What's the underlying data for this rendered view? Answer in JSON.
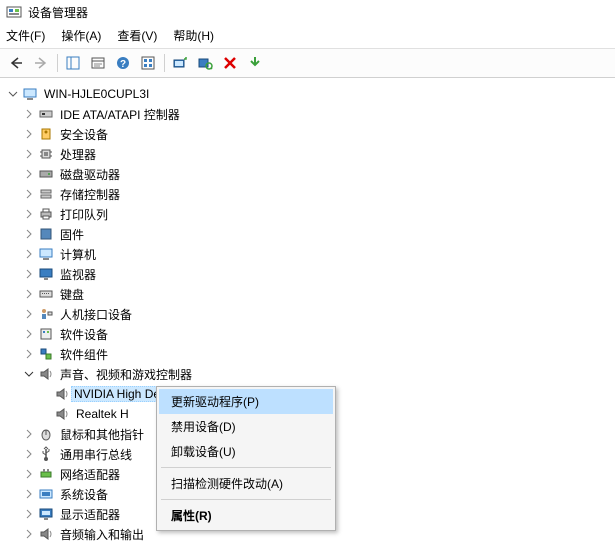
{
  "title": "设备管理器",
  "menus": {
    "file": "文件(F)",
    "action": "操作(A)",
    "view": "查看(V)",
    "help": "帮助(H)"
  },
  "tree": {
    "root": "WIN-HJLE0CUPL3I",
    "items": {
      "ide": "IDE ATA/ATAPI 控制器",
      "security": "安全设备",
      "cpu": "处理器",
      "disk": "磁盘驱动器",
      "storage": "存储控制器",
      "printq": "打印队列",
      "firmware": "固件",
      "computer": "计算机",
      "monitor": "监视器",
      "keyboard": "键盘",
      "hid": "人机接口设备",
      "software_devices": "软件设备",
      "software_components": "软件组件",
      "sound": "声音、视频和游戏控制器",
      "sound_children": {
        "nvidia": "NVIDIA High Definition Audio",
        "realtek": "Realtek H"
      },
      "mouse": "鼠标和其他指针",
      "usb": "通用串行总线",
      "network": "网络适配器",
      "system": "系统设备",
      "display": "显示适配器",
      "audioio": "音频输入和输出"
    }
  },
  "context_menu": {
    "update_driver": "更新驱动程序(P)",
    "disable": "禁用设备(D)",
    "uninstall": "卸载设备(U)",
    "scan": "扫描检测硬件改动(A)",
    "properties": "属性(R)"
  }
}
